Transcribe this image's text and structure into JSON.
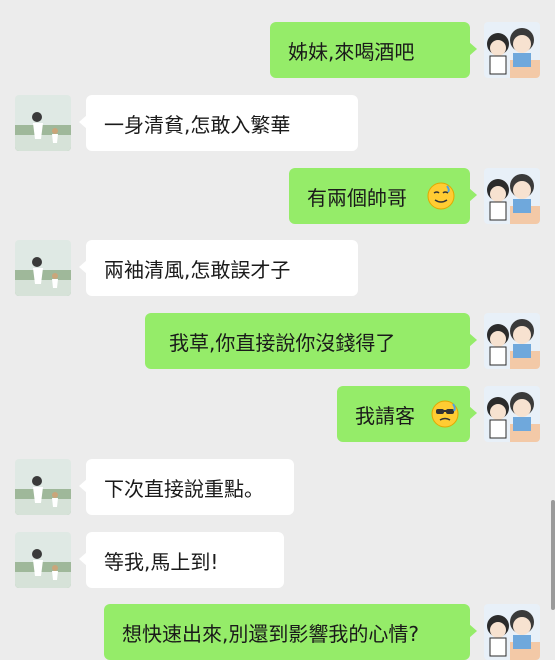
{
  "messages": [
    {
      "side": "right",
      "text": "姊妹,來喝酒吧"
    },
    {
      "side": "left",
      "text": "一身清貧,怎敢入繁華"
    },
    {
      "side": "right",
      "text": "有兩個帥哥",
      "emoji": "relieved-face-emoji"
    },
    {
      "side": "left",
      "text": "兩袖清風,怎敢誤才子"
    },
    {
      "side": "right",
      "text": "我草,你直接說你沒錢得了"
    },
    {
      "side": "right",
      "text": "我請客",
      "emoji": "sunglasses-sweat-emoji"
    },
    {
      "side": "left",
      "text": "下次直接說重點。"
    },
    {
      "side": "left",
      "text": "等我,馬上到!"
    },
    {
      "side": "right",
      "text": "想快速出來,別還到影響我的心情?"
    }
  ],
  "colors": {
    "background": "#ececec",
    "bubble_self": "#95ec69",
    "bubble_other": "#ffffff"
  }
}
